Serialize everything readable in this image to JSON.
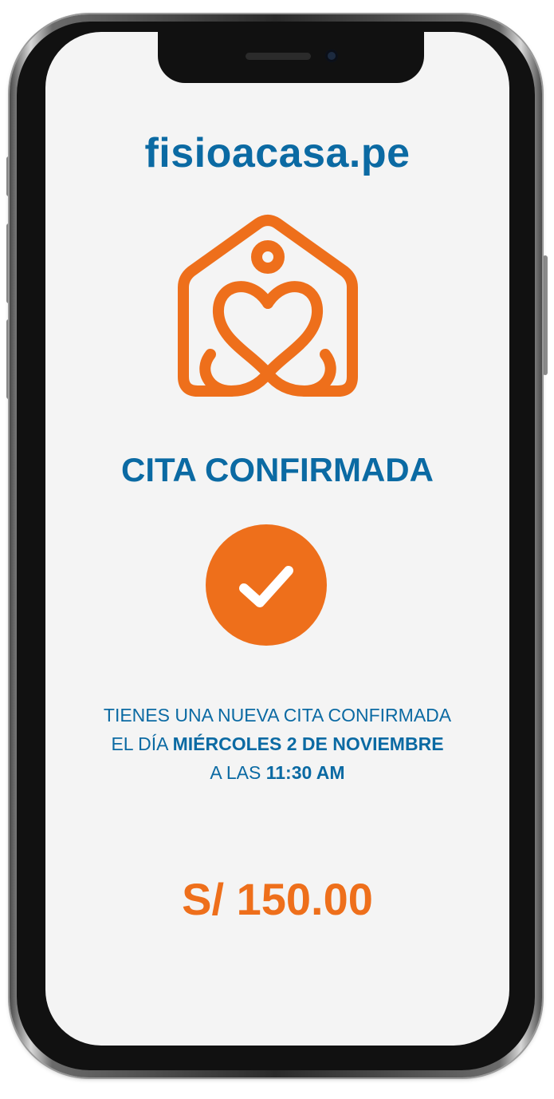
{
  "brand": {
    "name": "fisioacasa.pe"
  },
  "logo": {
    "icon": "house-heart-icon",
    "color": "#EE6F1B"
  },
  "confirmation": {
    "title": "CITA CONFIRMADA",
    "icon": "checkmark-icon",
    "message_line1": "TIENES UNA NUEVA CITA CONFIRMADA",
    "message_line2_prefix": "EL DÍA ",
    "date": "MIÉRCOLES 2 DE NOVIEMBRE",
    "message_line3_prefix": "A LAS ",
    "time": "11:30 AM",
    "price": "S/ 150.00"
  },
  "colors": {
    "brand_blue": "#0B6AA3",
    "accent_orange": "#EE6F1B",
    "screen_background": "#F4F4F4"
  }
}
